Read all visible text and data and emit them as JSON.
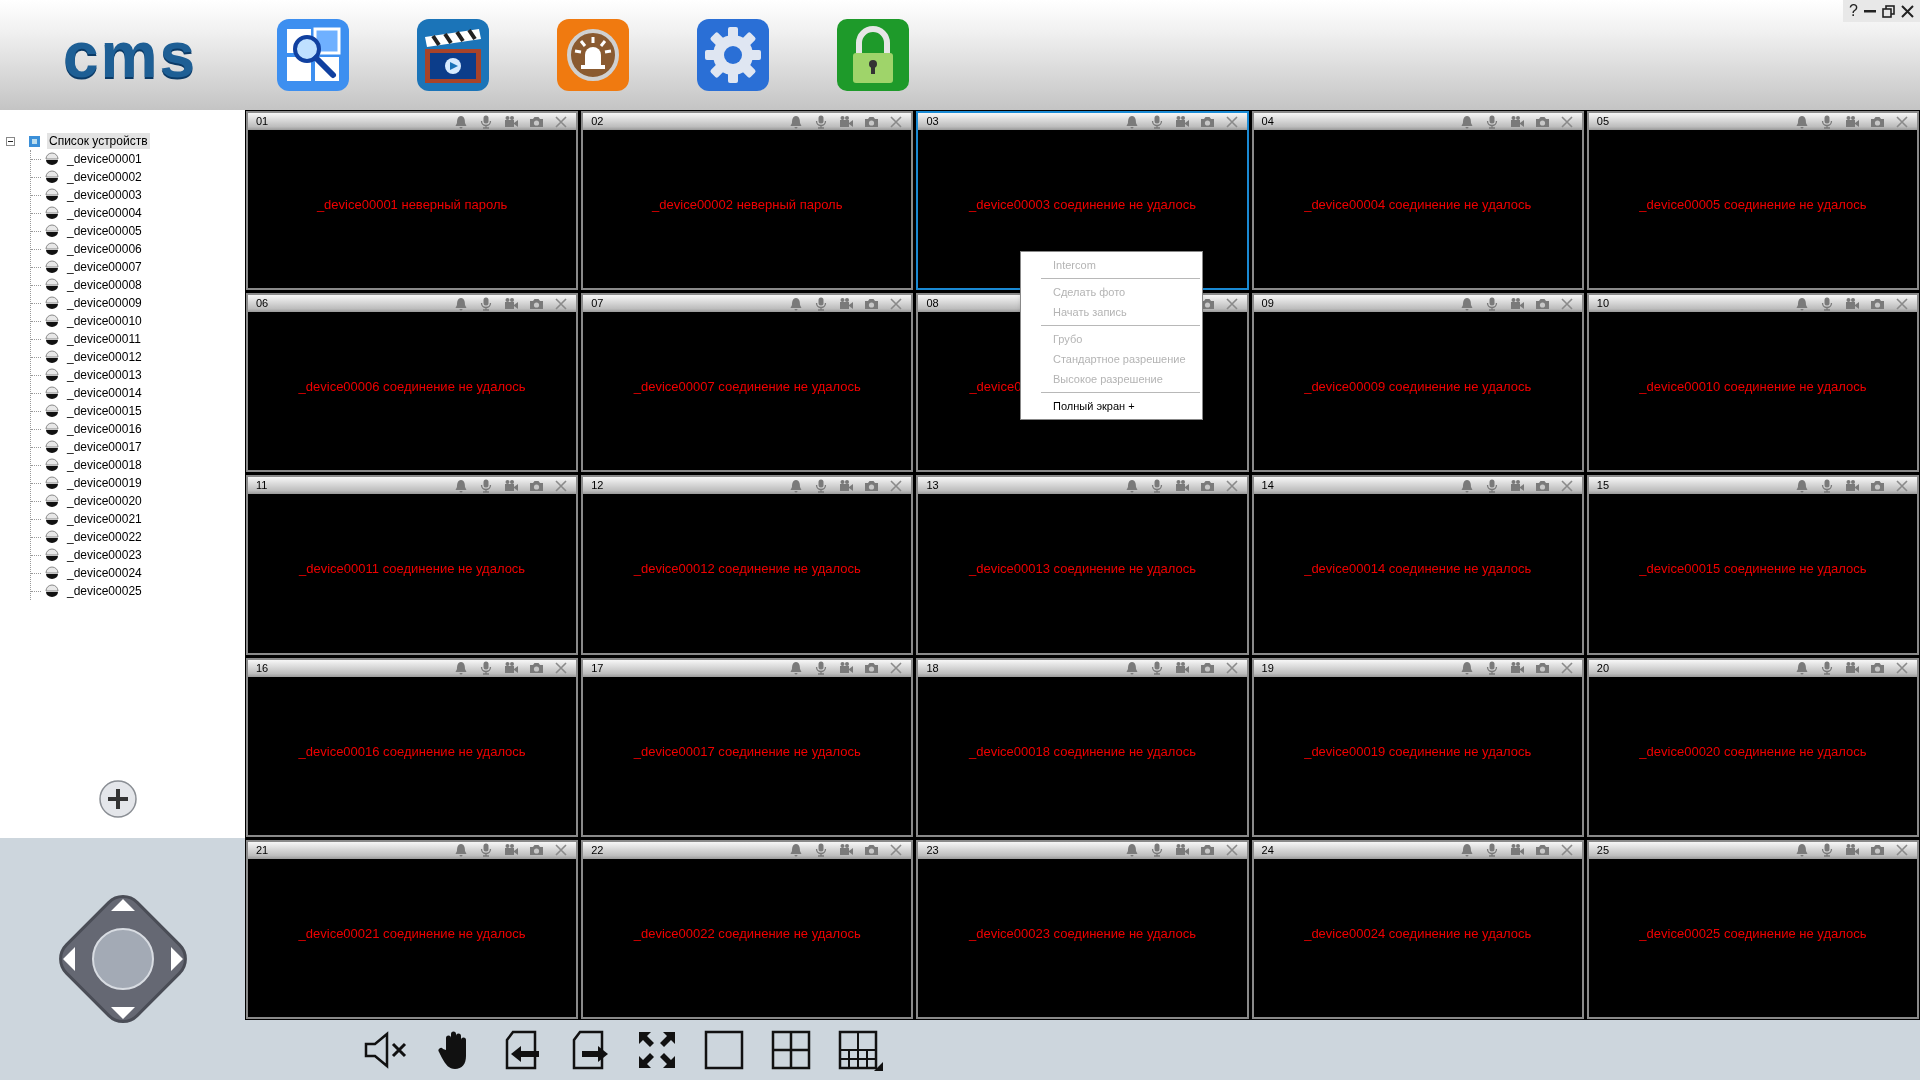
{
  "logo": "cms",
  "help_button": "?",
  "device_tree": {
    "label": "Список устройств",
    "expanded": true,
    "selected": true,
    "children": [
      {
        "label": "_device00001",
        "selected": false
      },
      {
        "label": "_device00002",
        "selected": false
      },
      {
        "label": "_device00003",
        "selected": false
      },
      {
        "label": "_device00004",
        "selected": false
      },
      {
        "label": "_device00005",
        "selected": false
      },
      {
        "label": "_device00006",
        "selected": false
      },
      {
        "label": "_device00007",
        "selected": false
      },
      {
        "label": "_device00008",
        "selected": false
      },
      {
        "label": "_device00009",
        "selected": false
      },
      {
        "label": "_device00010",
        "selected": false
      },
      {
        "label": "_device00011",
        "selected": false
      },
      {
        "label": "_device00012",
        "selected": false
      },
      {
        "label": "_device00013",
        "selected": false
      },
      {
        "label": "_device00014",
        "selected": false
      },
      {
        "label": "_device00015",
        "selected": false
      },
      {
        "label": "_device00016",
        "selected": false
      },
      {
        "label": "_device00017",
        "selected": false
      },
      {
        "label": "_device00018",
        "selected": false
      },
      {
        "label": "_device00019",
        "selected": false
      },
      {
        "label": "_device00020",
        "selected": false
      },
      {
        "label": "_device00021",
        "selected": false
      },
      {
        "label": "_device00022",
        "selected": false
      },
      {
        "label": "_device00023",
        "selected": false
      },
      {
        "label": "_device00024",
        "selected": false
      },
      {
        "label": "_device00025",
        "selected": false
      }
    ]
  },
  "tiles": [
    {
      "number": "01",
      "message": "_device00001 неверный пароль",
      "selected": false,
      "covered": false
    },
    {
      "number": "02",
      "message": "_device00002 неверный пароль",
      "selected": false,
      "covered": false
    },
    {
      "number": "03",
      "message": "_device00003 соединение не удалось",
      "selected": true,
      "covered": false
    },
    {
      "number": "04",
      "message": "_device00004 соединение не удалось",
      "selected": false,
      "covered": false
    },
    {
      "number": "05",
      "message": "_device00005 соединение не удалось",
      "selected": false,
      "covered": false
    },
    {
      "number": "06",
      "message": "_device00006 соединение не удалось",
      "selected": false,
      "covered": false
    },
    {
      "number": "07",
      "message": "_device00007 соединение не удалось",
      "selected": false,
      "covered": false
    },
    {
      "number": "08",
      "message": "_device0",
      "selected": false,
      "covered": true
    },
    {
      "number": "09",
      "message": "_device00009 соединение не удалось",
      "selected": false,
      "covered": false
    },
    {
      "number": "10",
      "message": "_device00010 соединение не удалось",
      "selected": false,
      "covered": false
    },
    {
      "number": "11",
      "message": "_device00011 соединение не удалось",
      "selected": false,
      "covered": false
    },
    {
      "number": "12",
      "message": "_device00012 соединение не удалось",
      "selected": false,
      "covered": false
    },
    {
      "number": "13",
      "message": "_device00013 соединение не удалось",
      "selected": false,
      "covered": false
    },
    {
      "number": "14",
      "message": "_device00014 соединение не удалось",
      "selected": false,
      "covered": false
    },
    {
      "number": "15",
      "message": "_device00015 соединение не удалось",
      "selected": false,
      "covered": false
    },
    {
      "number": "16",
      "message": "_device00016 соединение не удалось",
      "selected": false,
      "covered": false
    },
    {
      "number": "17",
      "message": "_device00017 соединение не удалось",
      "selected": false,
      "covered": false
    },
    {
      "number": "18",
      "message": "_device00018 соединение не удалось",
      "selected": false,
      "covered": false
    },
    {
      "number": "19",
      "message": "_device00019 соединение не удалось",
      "selected": false,
      "covered": false
    },
    {
      "number": "20",
      "message": "_device00020 соединение не удалось",
      "selected": false,
      "covered": false
    },
    {
      "number": "21",
      "message": "_device00021 соединение не удалось",
      "selected": false,
      "covered": false
    },
    {
      "number": "22",
      "message": "_device00022 соединение не удалось",
      "selected": false,
      "covered": false
    },
    {
      "number": "23",
      "message": "_device00023 соединение не удалось",
      "selected": false,
      "covered": false
    },
    {
      "number": "24",
      "message": "_device00024 соединение не удалось",
      "selected": false,
      "covered": false
    },
    {
      "number": "25",
      "message": "_device00025 соединение не удалось",
      "selected": false,
      "covered": false
    }
  ],
  "context_menu": {
    "groups": [
      [
        {
          "label": "Intercom",
          "disabled": true
        }
      ],
      [
        {
          "label": "Сделать фото",
          "disabled": true
        },
        {
          "label": "Начать запись",
          "disabled": true
        }
      ],
      [
        {
          "label": "Грубо",
          "disabled": true
        },
        {
          "label": "Стандартное разрешение",
          "disabled": true
        },
        {
          "label": "Высокое разрешение",
          "disabled": true
        }
      ],
      [
        {
          "label": "Полный экран +",
          "disabled": false
        }
      ]
    ]
  }
}
